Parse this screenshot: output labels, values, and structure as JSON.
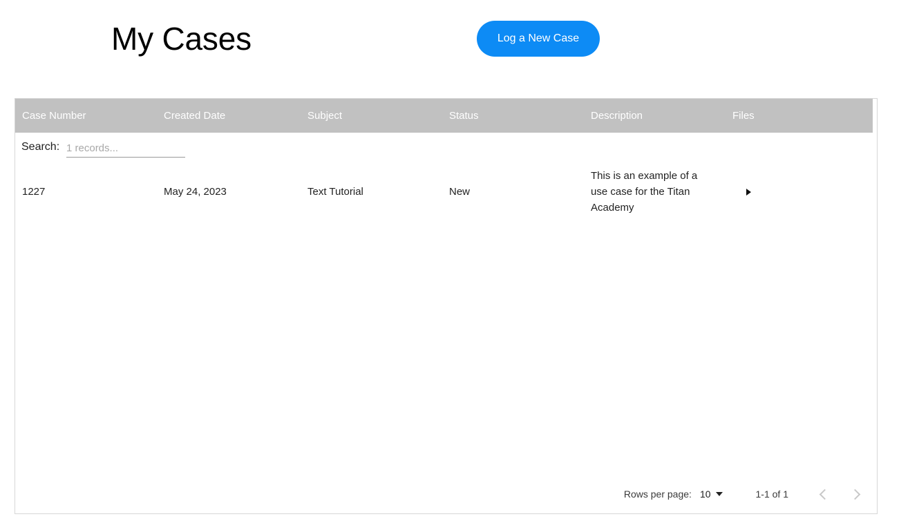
{
  "header": {
    "title": "My Cases",
    "new_case_label": "Log a New Case",
    "accent_color": "#0d8bf5"
  },
  "table": {
    "header_bg": "#c1c1c1",
    "columns": [
      {
        "key": "case_number",
        "label": "Case Number"
      },
      {
        "key": "created_date",
        "label": "Created Date"
      },
      {
        "key": "subject",
        "label": "Subject"
      },
      {
        "key": "status",
        "label": "Status"
      },
      {
        "key": "description",
        "label": "Description"
      },
      {
        "key": "files",
        "label": "Files"
      }
    ],
    "search": {
      "label": "Search:",
      "value": "",
      "placeholder": "1 records..."
    },
    "rows": [
      {
        "case_number": "1227",
        "created_date": "May 24, 2023",
        "subject": "Text Tutorial",
        "status": "New",
        "description": "This is an example of a use case for the Titan Academy",
        "files_icon": "expand-arrow-icon"
      }
    ]
  },
  "pagination": {
    "rows_per_page_label": "Rows per page:",
    "rows_per_page_value": "10",
    "range_label": "1-1 of 1",
    "previous_icon": "chevron-left-icon",
    "next_icon": "chevron-right-icon"
  }
}
